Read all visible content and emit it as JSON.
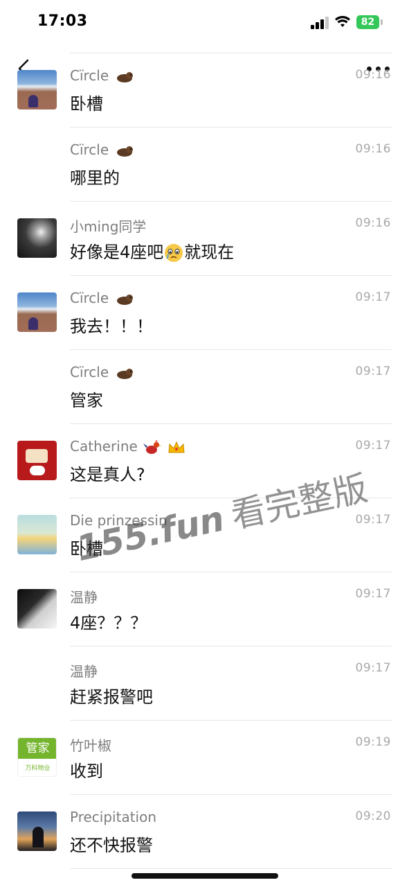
{
  "status_bar": {
    "time": "17:03",
    "battery": "82"
  },
  "icons": {
    "back": "chevron-left-icon",
    "more": "more-dots-icon",
    "signal": "cellular-signal-icon",
    "wifi": "wifi-icon",
    "battery": "battery-icon"
  },
  "messages": [
    {
      "name": "Cïrcle",
      "name_emoji": "otter-emoji",
      "time": "09:16",
      "text": "卧槽",
      "avatar": "mountain"
    },
    {
      "name": "Cïrcle",
      "name_emoji": "otter-emoji",
      "time": "09:16",
      "text": "哪里的",
      "avatar": ""
    },
    {
      "name": "小ming同学",
      "name_emoji": "",
      "time": "09:16",
      "text_before": "好像是4座吧",
      "text_emoji": "crying-face-emoji",
      "text_after": "就现在",
      "avatar": "dark"
    },
    {
      "name": "Cïrcle",
      "name_emoji": "otter-emoji",
      "time": "09:17",
      "text": "我去！！！",
      "avatar": "mountain"
    },
    {
      "name": "Cïrcle",
      "name_emoji": "otter-emoji",
      "time": "09:17",
      "text": "管家",
      "avatar": ""
    },
    {
      "name": "Catherine",
      "name_emoji": "rooster-crown-emoji",
      "time": "09:17",
      "text": "这是真人?",
      "avatar": "red"
    },
    {
      "name": "Die prinzessin",
      "name_emoji": "",
      "time": "09:17",
      "text": "卧槽",
      "avatar": "alice"
    },
    {
      "name": "温静",
      "name_emoji": "",
      "time": "09:17",
      "text": "4座？？？",
      "avatar": "piano"
    },
    {
      "name": "温静",
      "name_emoji": "",
      "time": "09:17",
      "text": "赶紧报警吧",
      "avatar": ""
    },
    {
      "name": "竹叶椒",
      "name_emoji": "",
      "time": "09:19",
      "text": "收到",
      "avatar": "green",
      "avatar_text_top": "管家",
      "avatar_text_bottom": "万科物业"
    },
    {
      "name": "Precipitation",
      "name_emoji": "",
      "time": "09:20",
      "text": "还不快报警",
      "avatar": "sunset"
    }
  ],
  "watermark": {
    "part1": "155.fun",
    "part2": "看完整版"
  }
}
